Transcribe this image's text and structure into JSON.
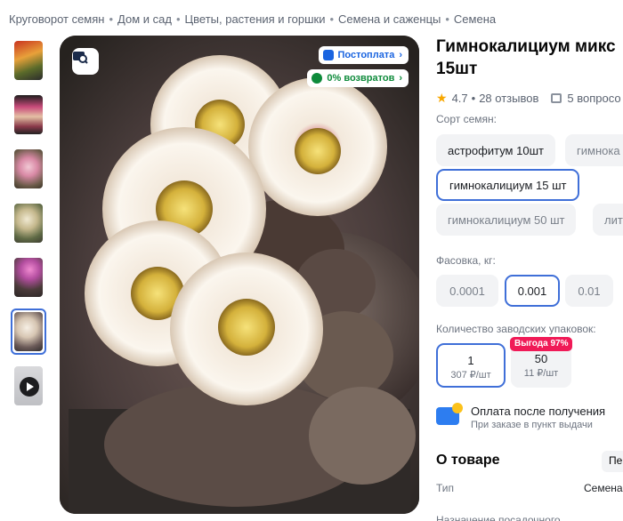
{
  "breadcrumbs": [
    "Круговорот семян",
    "Дом и сад",
    "Цветы, растения и горшки",
    "Семена и саженцы",
    "Семена"
  ],
  "gallery": {
    "thumbnails": [
      "photo-1",
      "photo-2",
      "photo-3",
      "photo-4",
      "photo-5",
      "photo-6",
      "video"
    ],
    "selected_index": 5,
    "badges": {
      "postpay": "Постоплата",
      "returns": "0% возвратов"
    }
  },
  "product": {
    "title_line1": "Гимнокалициум микс",
    "title_line2": "15шт",
    "rating": "4.7",
    "reviews": "28 отзывов",
    "questions": "5 вопросо",
    "separator": "•"
  },
  "variety": {
    "label": "Сорт семян:",
    "options": [
      "астрофитум 10шт",
      "гимнока",
      "гимнокалициум 15 шт",
      "гимнокалициум 50 шт",
      "лит"
    ],
    "selected": "гимнокалициум 15 шт"
  },
  "package": {
    "label": "Фасовка, кг:",
    "options": [
      "0.0001",
      "0.001",
      "0.01"
    ],
    "selected": "0.001"
  },
  "quantity": {
    "label": "Количество заводских упаковок:",
    "options": [
      {
        "count": "1",
        "price": "307 ₽/шт"
      },
      {
        "count": "50",
        "price": "11 ₽/шт"
      }
    ],
    "sale_tag": "Выгода 97%"
  },
  "payment": {
    "title": "Оплата после получения",
    "subtitle": "При заказе в пункт выдачи"
  },
  "about": {
    "heading": "О товаре",
    "tab": "Пер",
    "specs": [
      {
        "key": "Тип",
        "value": "Семена"
      },
      {
        "key": "Назначение посадочного",
        "value": ""
      }
    ]
  },
  "colors": {
    "accent": "#3f6fd8",
    "sale": "#f01a57",
    "star": "#f8a700",
    "postpay": "#1a64e0",
    "returns": "#0d8a3a"
  }
}
